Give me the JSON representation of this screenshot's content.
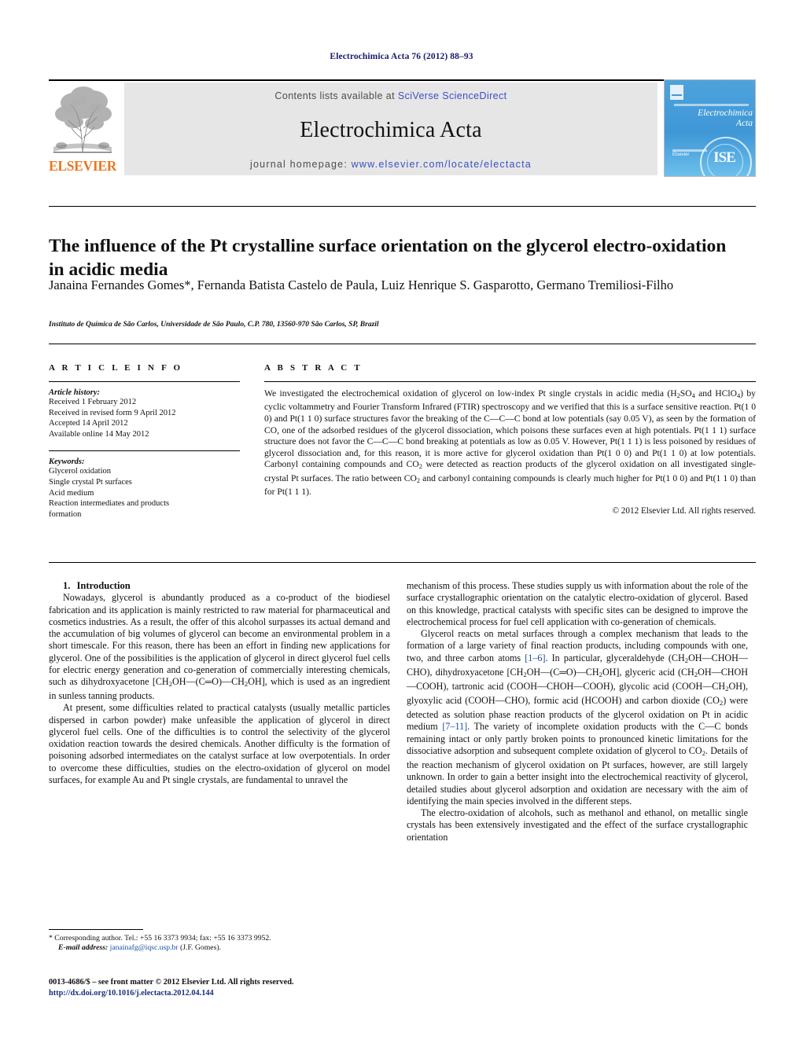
{
  "running_head": "Electrochimica Acta 76 (2012) 88–93",
  "masthead": {
    "contents_prefix": "Contents lists available at ",
    "sciencedirect_link": "SciVerse ScienceDirect",
    "journal_title": "Electrochimica Acta",
    "homepage_prefix": "journal homepage: ",
    "homepage_url": "www.elsevier.com/locate/electacta",
    "elsevier_wordmark": "ELSEVIER",
    "elsevier_orange": "#e87722",
    "link_blue": "#3b4fc4",
    "panel_gray": "#e6e6e6",
    "cover": {
      "title_line1": "Electrochimica",
      "title_line2": "Acta",
      "publisher": "Elsevier",
      "seal_text": "ISE",
      "background": "#3f97d6"
    }
  },
  "article": {
    "title": "The influence of the Pt crystalline surface orientation on the glycerol electro-oxidation in acidic media",
    "authors": "Janaina Fernandes Gomes*, Fernanda Batista Castelo de Paula, Luiz Henrique S. Gasparotto, Germano Tremiliosi-Filho",
    "affiliation": "Instituto de Química de São Carlos, Universidade de São Paulo, C.P. 780, 13560-970 São Carlos, SP, Brazil"
  },
  "article_info": {
    "label": "A R T I C L E   I N F O",
    "history_heading": "Article history:",
    "history": [
      "Received 1 February 2012",
      "Received in revised form 9 April 2012",
      "Accepted 14 April 2012",
      "Available online 14 May 2012"
    ],
    "keywords_heading": "Keywords:",
    "keywords": [
      "Glycerol oxidation",
      "Single crystal Pt surfaces",
      "Acid medium",
      "Reaction intermediates and products",
      "formation"
    ]
  },
  "abstract": {
    "label": "A B S T R A C T",
    "paragraph_1": "We investigated the electrochemical oxidation of glycerol on low-index Pt single crystals in acidic media (H",
    "paragraph_2": "SO",
    "paragraph_3": " and HClO",
    "paragraph_4": ") by cyclic voltammetry and Fourier Transform Infrared (FTIR) spectroscopy and we verified that this is a surface sensitive reaction. Pt(1 0 0) and Pt(1 1 0) surface structures favor the breaking of the C—C—C bond at low potentials (say 0.05 V), as seen by the formation of CO, one of the adsorbed residues of the glycerol dissociation, which poisons these surfaces even at high potentials. Pt(1 1 1) surface structure does not favor the C—C—C bond breaking at potentials as low as 0.05 V. However, Pt(1 1 1) is less poisoned by residues of glycerol dissociation and, for this reason, it is more active for glycerol oxidation than Pt(1 0 0) and Pt(1 1 0) at low potentials. Carbonyl containing compounds and CO",
    "paragraph_5": " were detected as reaction products of the glycerol oxidation on all investigated single-crystal Pt surfaces. The ratio between CO",
    "paragraph_6": " and carbonyl containing compounds is clearly much higher for Pt(1 0 0) and Pt(1 1 0) than for Pt(1 1 1).",
    "sub_2a": "2",
    "sub_4": "4",
    "sub_2b": "2",
    "copyright": "© 2012 Elsevier Ltd. All rights reserved."
  },
  "body": {
    "section_number": "1.",
    "section_title": "Introduction",
    "left_p1": "Nowadays, glycerol is abundantly produced as a co-product of the biodiesel fabrication and its application is mainly restricted to raw material for pharmaceutical and cosmetics industries. As a result, the offer of this alcohol surpasses its actual demand and the accumulation of big volumes of glycerol can become an environmental problem in a short timescale. For this reason, there has been an effort in finding new applications for glycerol. One of the possibilities is the application of glycerol in direct glycerol fuel cells for electric energy generation and co-generation of commercially interesting chemicals, such as dihydroxyacetone [CH",
    "left_p1_b": "OH—(C═O)—CH",
    "left_p1_c": "OH], which is used as an ingredient in sunless tanning products.",
    "left_p2": "At present, some difficulties related to practical catalysts (usually metallic particles dispersed in carbon powder) make unfeasible the application of glycerol in direct glycerol fuel cells. One of the difficulties is to control the selectivity of the glycerol oxidation reaction towards the desired chemicals. Another difficulty is the formation of poisoning adsorbed intermediates on the catalyst surface at low overpotentials. In order to overcome these difficulties, studies on the electro-oxidation of glycerol on model surfaces, for example Au and Pt single crystals, are fundamental to unravel the",
    "right_p1": "mechanism of this process. These studies supply us with information about the role of the surface crystallographic orientation on the catalytic electro-oxidation of glycerol. Based on this knowledge, practical catalysts with specific sites can be designed to improve the electrochemical process for fuel cell application with co-generation of chemicals.",
    "right_p2_a": "Glycerol reacts on metal surfaces through a complex mechanism that leads to the formation of a large variety of final reaction products, including compounds with one, two, and three carbon atoms ",
    "right_cite_1": "[1–6]",
    "right_p2_b": ". In particular, glyceraldehyde (CH",
    "right_p2_c": "OH—CHOH—CHO), dihydroxyacetone  [CH",
    "right_p2_d": "OH—(C═O)—CH",
    "right_p2_e": "OH],  glyceric  acid (CH",
    "right_p2_f": "OH—CHOH—COOH), tartronic acid (COOH—CHOH—COOH), glycolic acid (COOH—CH",
    "right_p2_g": "OH), glyoxylic acid (COOH—CHO), formic acid (HCOOH) and carbon dioxide (CO",
    "right_p2_h": ") were detected as solution phase reaction products of the glycerol oxidation on Pt in acidic medium ",
    "right_cite_2": "[7–11]",
    "right_p2_i": ". The variety of incomplete oxidation products with the C—C bonds remaining intact or only partly broken points to pronounced kinetic limitations for the dissociative adsorption and subsequent complete oxidation of glycerol to CO",
    "right_p2_j": ". Details of the reaction mechanism of glycerol oxidation on Pt surfaces, however, are still largely unknown. In order to gain a better insight into the electrochemical reactivity of glycerol, detailed studies about glycerol adsorption and oxidation are necessary with the aim of identifying the main species involved in the different steps.",
    "right_p3": "The electro-oxidation of alcohols, such as methanol and ethanol, on metallic single crystals has been extensively investigated and the effect of the surface crystallographic orientation"
  },
  "footer": {
    "corresponding": "* Corresponding author. Tel.: +55 16 3373 9934; fax: +55 16 3373 9952.",
    "email_label": "E-mail address:",
    "email": "janainafg@iqsc.usp.br",
    "email_suffix": "(J.F. Gomes).",
    "issn_line": "0013-4686/$ – see front matter © 2012 Elsevier Ltd. All rights reserved.",
    "doi": "http://dx.doi.org/10.1016/j.electacta.2012.04.144"
  }
}
